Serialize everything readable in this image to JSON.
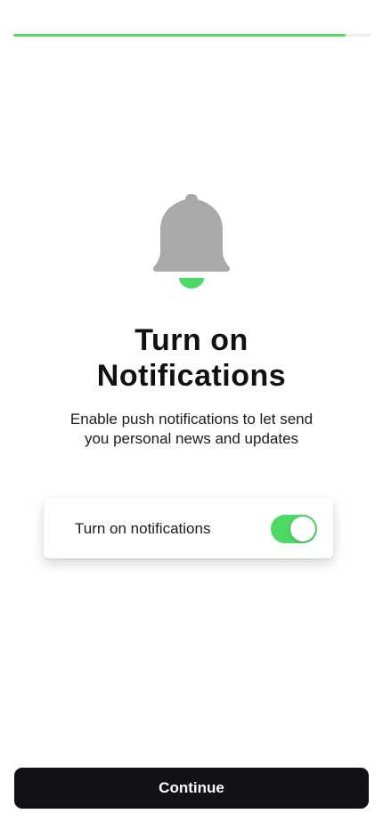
{
  "progress": {
    "value": 0.93,
    "fill_color": "#4cd964",
    "track_color": "#eeeeee"
  },
  "hero": {
    "icon": "bell-icon",
    "bell_color": "#a9a9a9",
    "clapper_color": "#4cd964"
  },
  "title": {
    "line1": "Turn on",
    "line2": "Notifications"
  },
  "subtitle": {
    "line1": "Enable push notifications to let send",
    "line2": "you personal news and updates"
  },
  "toggle": {
    "label": "Turn on notifications",
    "state": "on",
    "on_color": "#4cd964"
  },
  "continue_button": {
    "label": "Continue",
    "bg_color": "#111217"
  }
}
